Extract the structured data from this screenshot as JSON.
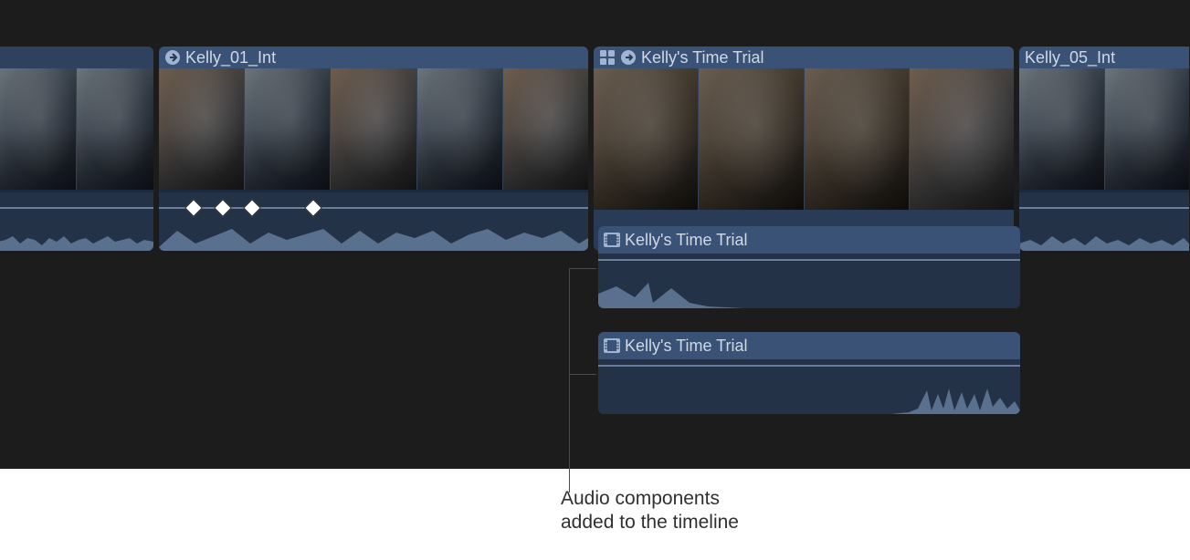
{
  "clips": {
    "clip_a": {
      "name": ""
    },
    "clip_b": {
      "name": "Kelly_01_Int"
    },
    "clip_c": {
      "name": "Kelly's Time Trial"
    },
    "clip_d": {
      "name": "Kelly_05_Int"
    }
  },
  "components": {
    "comp1": {
      "name": "Kelly's Time Trial"
    },
    "comp2": {
      "name": "Kelly's Time Trial"
    }
  },
  "annotation": {
    "line1": "Audio components",
    "line2": "added to the timeline"
  },
  "icons": {
    "multicam": "multicam-icon",
    "through_edit": "through-edit-icon",
    "filmstrip": "filmstrip-icon"
  },
  "colors": {
    "timeline_bg": "#1c1c1c",
    "clip_header": "#3a5276",
    "clip_body": "#2a3b57",
    "audio_body": "#243248",
    "level_line": "#6a7e9b",
    "waveform": "#5a708f",
    "text": "#cfd9e6"
  }
}
